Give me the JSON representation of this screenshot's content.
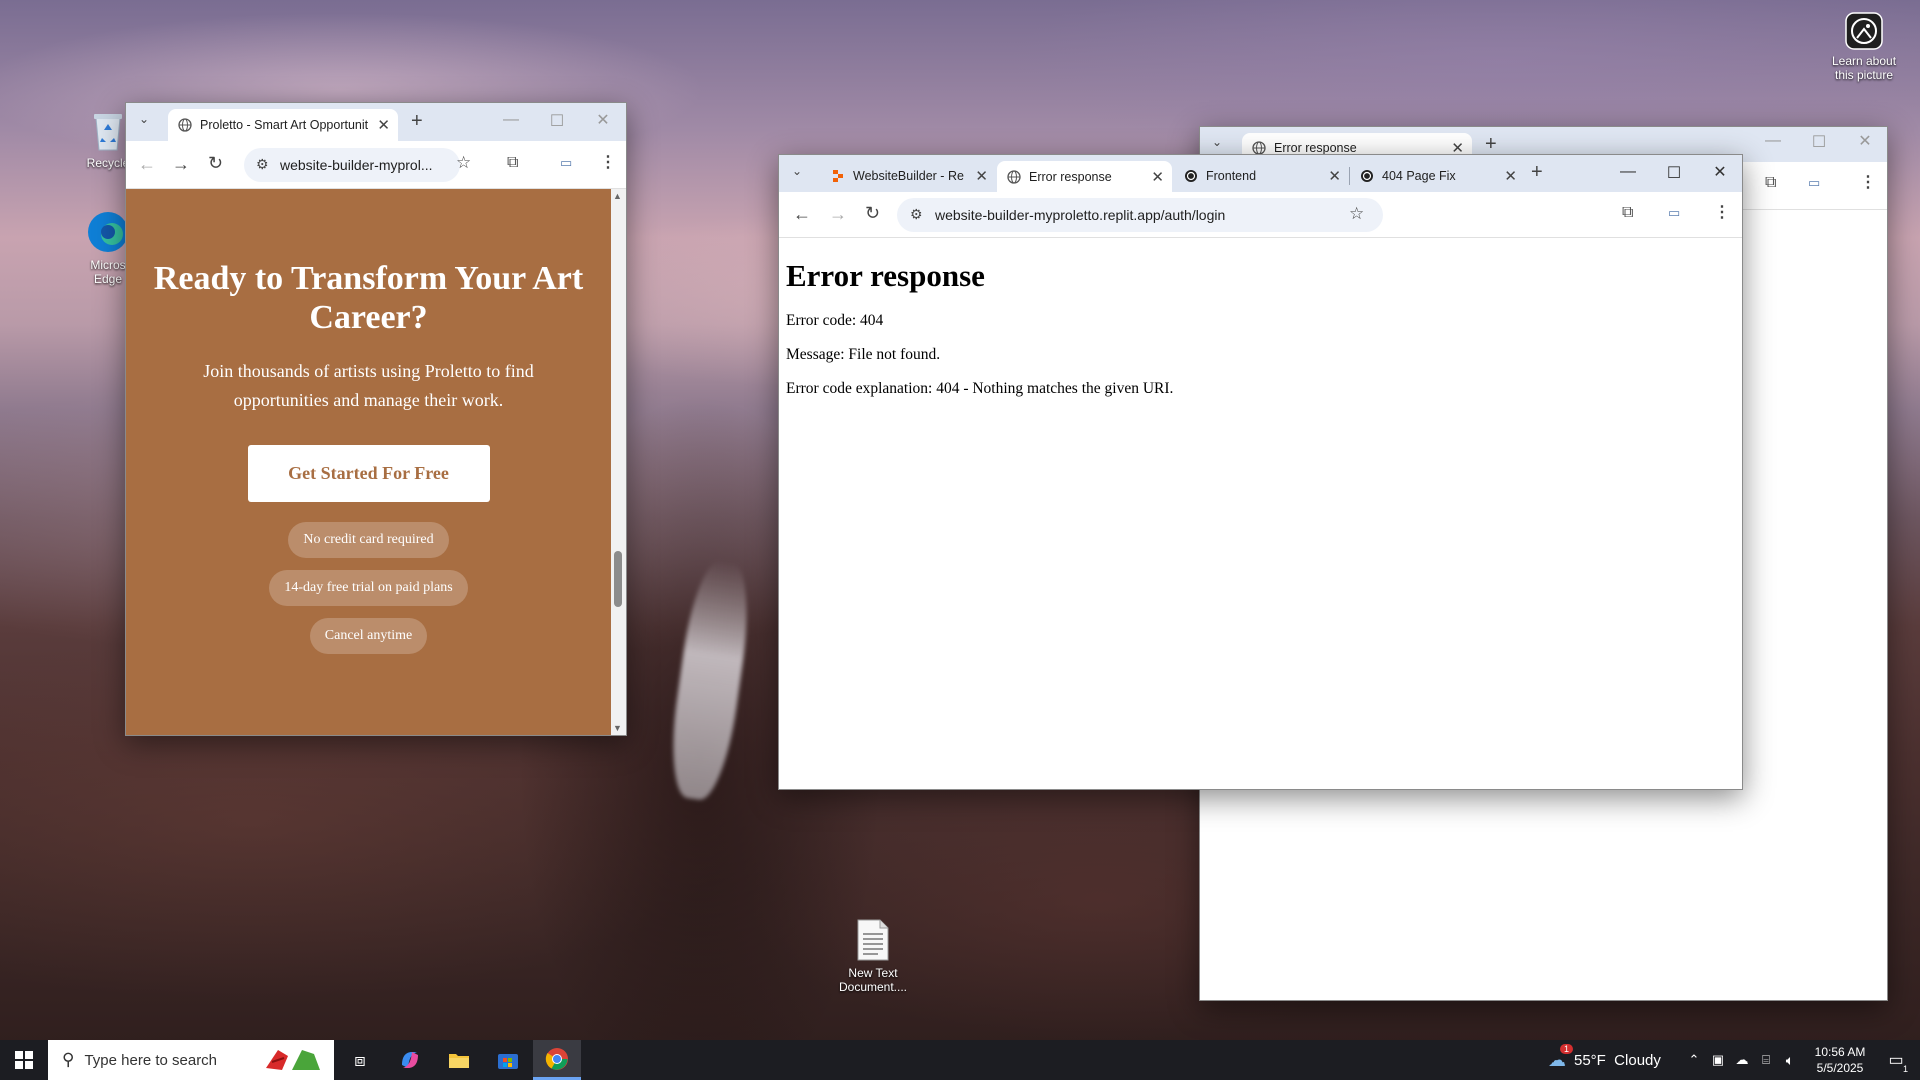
{
  "desktop": {
    "recycle_bin_label": "Recycle",
    "edge_label_line1": "Micros",
    "edge_label_line2": "Edge",
    "text_doc_line1": "New Text",
    "text_doc_line2": "Document....",
    "learn_line1": "Learn about",
    "learn_line2": "this picture"
  },
  "window_left": {
    "tab_title": "Proletto - Smart Art Opportunit",
    "url": "website-builder-myprol...",
    "heading": "Ready to Transform Your Art Career?",
    "subtext": "Join thousands of artists using Proletto to find opportunities and manage their work.",
    "cta": "Get Started For Free",
    "badges": [
      "No credit card required",
      "14-day free trial on paid plans",
      "Cancel anytime"
    ],
    "accent": "#a86e42"
  },
  "window_back": {
    "tab_title": "Error response"
  },
  "window_main": {
    "tabs": [
      {
        "title": "WebsiteBuilder - Re"
      },
      {
        "title": "Error response"
      },
      {
        "title": "Frontend"
      },
      {
        "title": "404 Page Fix"
      }
    ],
    "url": "website-builder-myproletto.replit.app/auth/login",
    "page": {
      "heading": "Error response",
      "line1": "Error code: 404",
      "line2": "Message: File not found.",
      "line3": "Error code explanation: 404 - Nothing matches the given URI."
    }
  },
  "taskbar": {
    "search_placeholder": "Type here to search",
    "weather": "55°F  Cloudy",
    "weather_badge": "1",
    "time": "10:56 AM",
    "date": "5/5/2025",
    "notification_count": "1"
  }
}
